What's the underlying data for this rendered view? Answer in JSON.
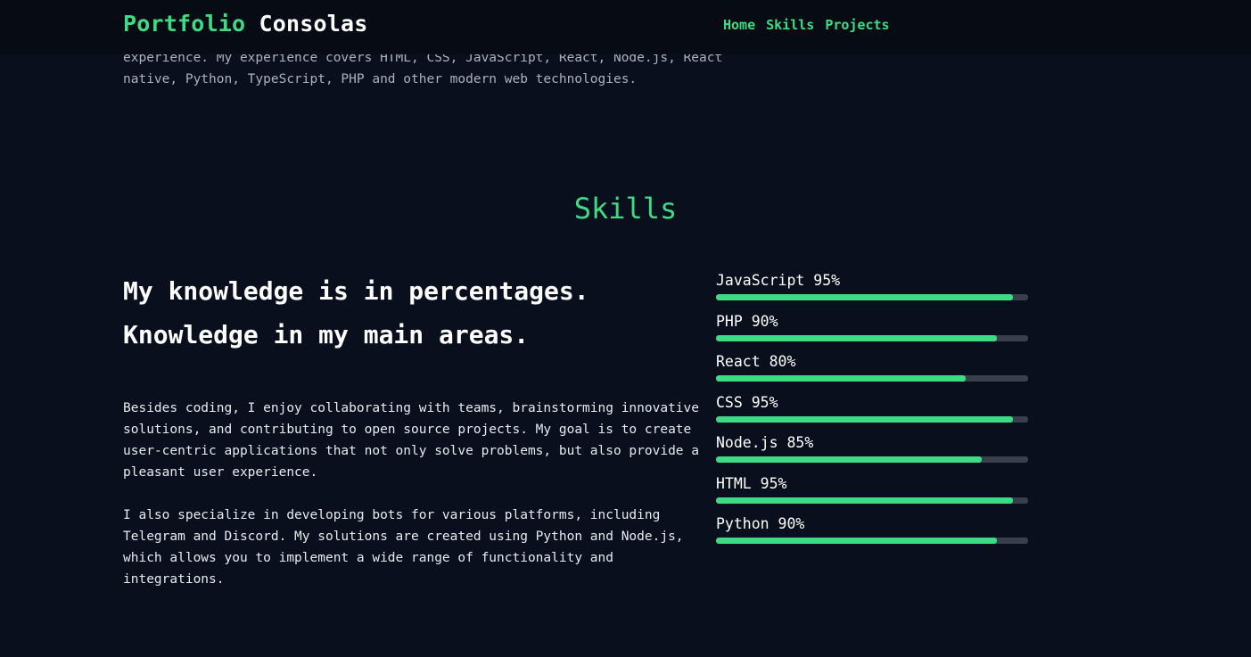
{
  "header": {
    "brand_accent": "Portfolio",
    "brand_main": "Consolas",
    "nav": [
      {
        "label": "Home"
      },
      {
        "label": "Skills"
      },
      {
        "label": "Projects"
      }
    ]
  },
  "intro": {
    "text": "experience. My experience covers HTML, CSS, JavaScript, React, Node.js, React native, Python, TypeScript, PHP and other modern web technologies."
  },
  "skills_section": {
    "title": "Skills",
    "heading": "My knowledge is in percentages. Knowledge in my main areas.",
    "paragraphs": [
      "Besides coding, I enjoy collaborating with teams, brainstorming innovative solutions, and contributing to open source projects. My goal is to create user-centric applications that not only solve problems, but also provide a pleasant user experience.",
      "I also specialize in developing bots for various platforms, including Telegram and Discord. My solutions are created using Python and Node.js, which allows you to implement a wide range of functionality and integrations."
    ],
    "skills": [
      {
        "name": "JavaScript",
        "percent": 95,
        "label": "JavaScript 95%"
      },
      {
        "name": "PHP",
        "percent": 90,
        "label": "PHP 90%"
      },
      {
        "name": "React",
        "percent": 80,
        "label": "React 80%"
      },
      {
        "name": "CSS",
        "percent": 95,
        "label": "CSS 95%"
      },
      {
        "name": "Node.js",
        "percent": 85,
        "label": "Node.js 85%"
      },
      {
        "name": "HTML",
        "percent": 95,
        "label": "HTML 95%"
      },
      {
        "name": "Python",
        "percent": 90,
        "label": "Python 90%"
      }
    ]
  },
  "colors": {
    "accent": "#3ddc84",
    "background": "#090f1c",
    "header_background": "#060b14",
    "bar_track": "#3a3f4b"
  }
}
